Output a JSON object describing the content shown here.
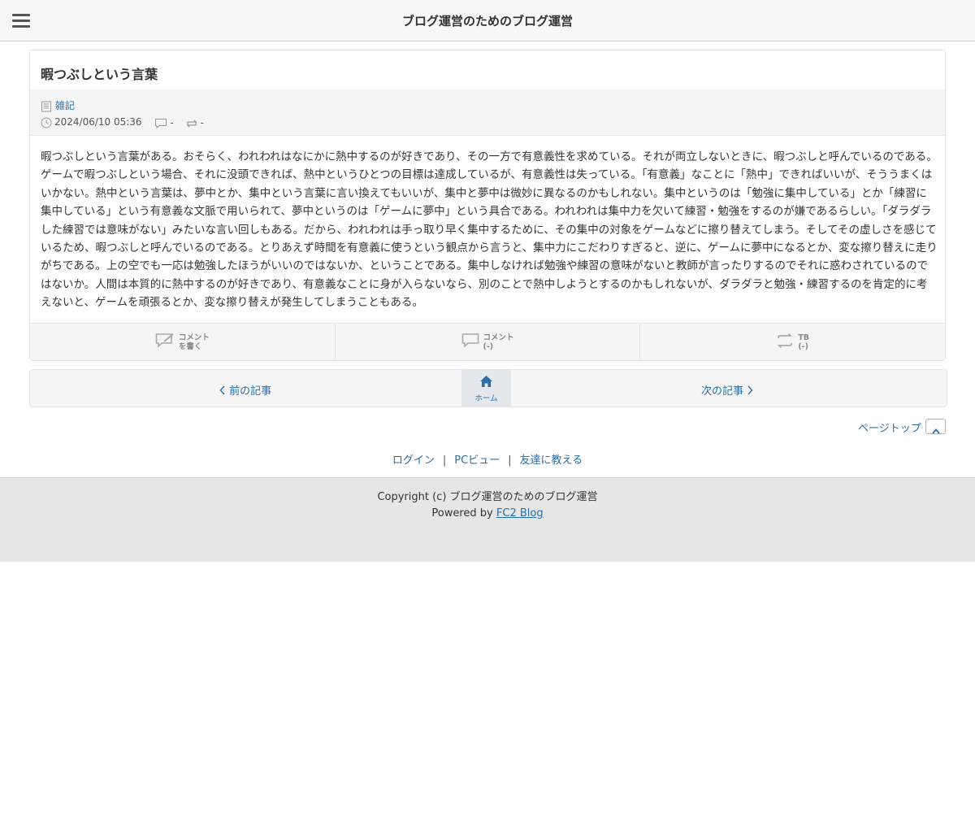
{
  "header": {
    "site_title": "ブログ運営のためのブログ運営",
    "menu_icon": "hamburger-icon"
  },
  "entry": {
    "title": "暇つぶしという言葉",
    "category": "雑記",
    "datetime": "2024/06/10 05:36",
    "comment_count": "-",
    "trackback_count": "-",
    "body": "暇つぶしという言葉がある。おそらく、われわれはなにかに熱中するのが好きであり、その一方で有意義性を求めている。それが両立しないときに、暇つぶしと呼んでいるのである。ゲームで暇つぶしという場合、それに没頭できれば、熱中というひとつの目標は達成しているが、有意義性は失っている。「有意義」なことに「熱中」できればいいが、そううまくはいかない。熱中という言葉は、夢中とか、集中という言葉に言い換えてもいいが、集中と夢中は微妙に異なるのかもしれない。集中というのは「勉強に集中している」とか「練習に集中している」という有意義な文脈で用いられて、夢中というのは「ゲームに夢中」という具合である。われわれは集中力を欠いて練習・勉強をするのが嫌であるらしい。「ダラダラした練習では意味がない」みたいな言い回しもある。だから、われわれは手っ取り早く集中するために、その集中の対象をゲームなどに擦り替えてしまう。そしてその虚しさを感じているため、暇つぶしと呼んでいるのである。とりあえず時間を有意義に使うという観点から言うと、集中力にこだわりすぎると、逆に、ゲームに夢中になるとか、変な擦り替えに走りがちである。上の空でも一応は勉強したほうがいいのではないか、ということである。集中しなければ勉強や練習の意味がないと教師が言ったりするのでそれに惑わされているのではないか。人間は本質的に熱中するのが好きであり、有意義なことに身が入らないなら、別のことで熱中しようとするのかもしれないが、ダラダラと勉強・練習するのを肯定的に考えないと、ゲームを頑張るとか、変な擦り替えが発生してしまうこともある。"
  },
  "actions": {
    "write_comment": {
      "line1": "コメント",
      "line2": "を書く"
    },
    "comments": {
      "line1": "コメント",
      "line2": "(-)"
    },
    "trackback": {
      "line1": "TB",
      "line2": "(-)"
    }
  },
  "pager": {
    "prev": "前の記事",
    "next": "次の記事",
    "home": "ホーム"
  },
  "pagetop": "ページトップ",
  "links": {
    "login": "ログイン",
    "pc_view": "PCビュー",
    "tell_friend": "友達に教える",
    "separator": "|"
  },
  "footer": {
    "copyright": "Copyright (c) ブログ運営のためのブログ運営",
    "powered_prefix": "Powered by ",
    "powered_link": "FC2 Blog"
  },
  "colors": {
    "link": "#2a6ea8",
    "header_bg": "#f7f7f7",
    "footer_bg": "#e6e6e6",
    "icon_gray": "#999999"
  }
}
